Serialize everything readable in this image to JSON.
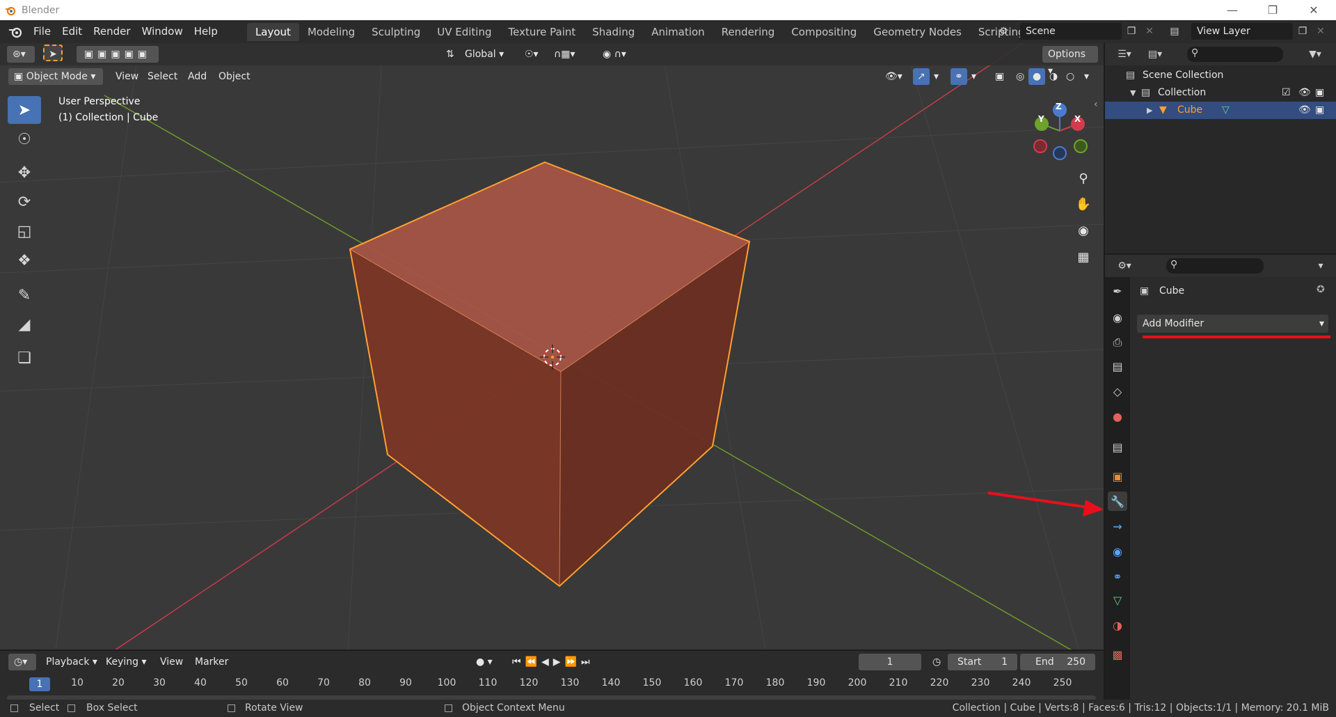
{
  "window": {
    "title": "Blender"
  },
  "menu": {
    "items": [
      "File",
      "Edit",
      "Render",
      "Window",
      "Help"
    ]
  },
  "workspaces": {
    "tabs": [
      "Layout",
      "Modeling",
      "Sculpting",
      "UV Editing",
      "Texture Paint",
      "Shading",
      "Animation",
      "Rendering",
      "Compositing",
      "Geometry Nodes",
      "Scripting"
    ],
    "active": "Layout",
    "add_symbol": "+"
  },
  "scene": {
    "name": "Scene"
  },
  "view_layer": {
    "name": "View Layer"
  },
  "viewport": {
    "mode": "Object Mode",
    "menus": [
      "View",
      "Select",
      "Add",
      "Object"
    ],
    "orientation": "Global",
    "options_label": "Options",
    "overlay_line1": "User Perspective",
    "overlay_line2": "(1) Collection | Cube",
    "gizmo": {
      "z": "Z",
      "y": "Y",
      "x": "X"
    }
  },
  "outliner": {
    "rows": [
      {
        "label": "Scene Collection"
      },
      {
        "label": "Collection"
      },
      {
        "label": "Cube"
      }
    ]
  },
  "properties": {
    "object_name": "Cube",
    "add_modifier_label": "Add Modifier",
    "active_tab": "modifier"
  },
  "timeline": {
    "menus": [
      "Playback",
      "Keying",
      "View",
      "Marker"
    ],
    "current_frame": "1",
    "start_label": "Start",
    "start_value": "1",
    "end_label": "End",
    "end_value": "250",
    "ticks": [
      "10",
      "20",
      "30",
      "40",
      "50",
      "60",
      "70",
      "80",
      "90",
      "100",
      "110",
      "120",
      "130",
      "140",
      "150",
      "160",
      "170",
      "180",
      "190",
      "200",
      "210",
      "220",
      "230",
      "240",
      "250"
    ],
    "ruler_current": "1"
  },
  "statusbar": {
    "select": "Select",
    "box_select": "Box Select",
    "rotate_view": "Rotate View",
    "context_menu": "Object Context Menu",
    "stats": "Collection | Cube | Verts:8 | Faces:6 | Tris:12 | Objects:1/1 | Memory: 20.1 MiB"
  },
  "colors": {
    "accent": "#4772b3",
    "selection_orange": "#ffa030",
    "annotation_red": "#e8101a",
    "x_axis": "#c63b4c",
    "y_axis": "#6e9a2b"
  }
}
